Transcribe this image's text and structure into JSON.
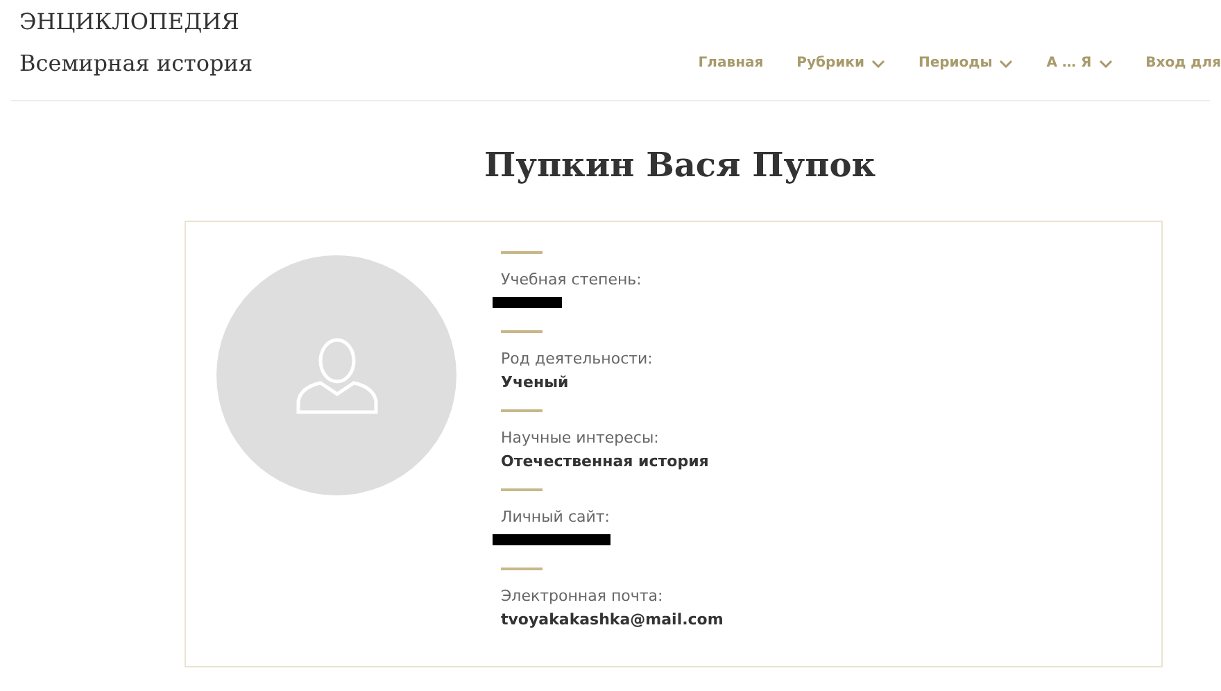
{
  "site": {
    "name": "ЭНЦИКЛОПЕДИЯ",
    "subtitle": "Всемирная история"
  },
  "nav": [
    {
      "label": "Главная",
      "dropdown": false
    },
    {
      "label": "Рубрики",
      "dropdown": true
    },
    {
      "label": "Периоды",
      "dropdown": true
    },
    {
      "label": "А … Я",
      "dropdown": true
    },
    {
      "label": "Вход для",
      "dropdown": false
    }
  ],
  "page_title": "Пупкин Вася Пупок",
  "profile": {
    "fields": [
      {
        "label": "Учебная степень:",
        "redacted": true
      },
      {
        "label": "Род деятельности:",
        "value": "Ученый",
        "redacted": false
      },
      {
        "label": "Научные интересы:",
        "value": "Отечественная история",
        "redacted": false
      },
      {
        "label": "Личный сайт:",
        "redacted": true
      },
      {
        "label": "Электронная почта:",
        "value": "tvoyakakashka@mail.com",
        "redacted": false
      }
    ]
  }
}
